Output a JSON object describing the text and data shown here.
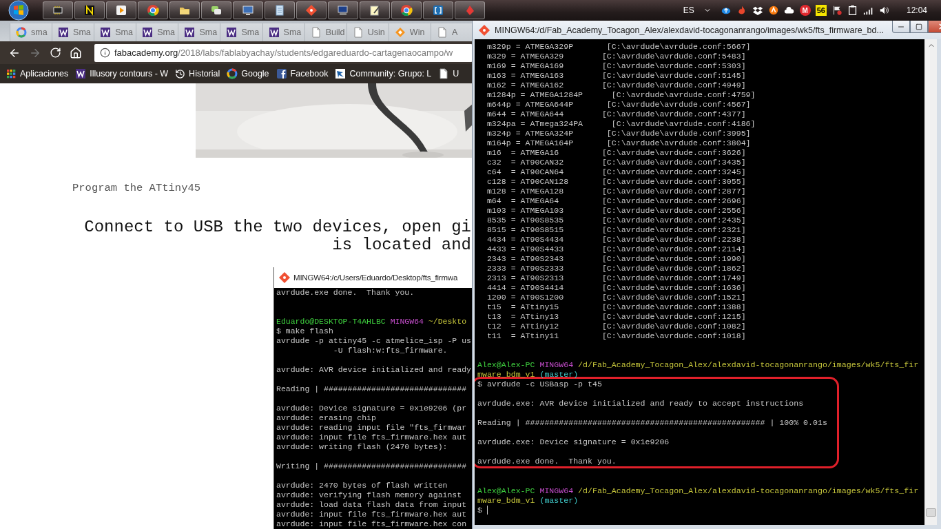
{
  "taskbar": {
    "apps": [
      {
        "kind": "chip"
      },
      {
        "kind": "logo"
      },
      {
        "kind": "player"
      },
      {
        "kind": "browser"
      },
      {
        "kind": "folder"
      },
      {
        "kind": "chat"
      },
      {
        "kind": "monitor"
      },
      {
        "kind": "notepad"
      },
      {
        "kind": "diamond"
      },
      {
        "kind": "computer"
      },
      {
        "kind": "notes"
      },
      {
        "kind": "browser"
      },
      {
        "kind": "bracket"
      },
      {
        "kind": "pin"
      }
    ],
    "language": "ES",
    "tray": [
      {
        "kind": "upload"
      },
      {
        "kind": "flame"
      },
      {
        "kind": "dropbox"
      },
      {
        "kind": "shield"
      },
      {
        "kind": "cloud"
      },
      {
        "kind": "letter",
        "label": "M"
      },
      {
        "kind": "badge",
        "label": "56"
      },
      {
        "kind": "flag"
      },
      {
        "kind": "clipboard"
      },
      {
        "kind": "signal"
      },
      {
        "kind": "speaker"
      }
    ],
    "time": "12:04"
  },
  "browser": {
    "tabs": [
      {
        "kind": "google",
        "label": "sma"
      },
      {
        "kind": "w",
        "label": "Sma"
      },
      {
        "kind": "w",
        "label": "Sma"
      },
      {
        "kind": "w",
        "label": "Sma"
      },
      {
        "kind": "w",
        "label": "Sma"
      },
      {
        "kind": "w",
        "label": "Sma"
      },
      {
        "kind": "w",
        "label": "Sma"
      },
      {
        "kind": "page",
        "label": "Build"
      },
      {
        "kind": "page",
        "label": "Usin"
      },
      {
        "kind": "diamond",
        "label": "Win"
      },
      {
        "kind": "page",
        "label": "A"
      }
    ],
    "url": "fabacademy.org/2018/labs/fablabyachay/students/edgareduardo-cartagenaocampo/w",
    "bookmarks": [
      {
        "kind": "apps",
        "label": "Aplicaciones"
      },
      {
        "kind": "w",
        "label": "Illusory contours - W"
      },
      {
        "kind": "history",
        "label": "Historial"
      },
      {
        "kind": "google",
        "label": "Google"
      },
      {
        "kind": "facebook",
        "label": "Facebook"
      },
      {
        "kind": "bird",
        "label": "Community: Grupo: L"
      },
      {
        "kind": "page",
        "label": "U"
      }
    ],
    "page": {
      "photo": {
        "kind": "picture"
      },
      "caption": "Program the ATtiny45",
      "heading_lines": [
        "Connect to USB the two devices, open gi",
        "is located and"
      ]
    }
  },
  "small_terminal": {
    "title": "MINGW64:/c/Users/Eduardo/Desktop/fts_firmwa",
    "lines": [
      {
        "kind": "text",
        "text": "avrdude.exe done.  Thank you."
      },
      {
        "kind": "blank"
      },
      {
        "kind": "blank"
      },
      {
        "kind": "segs",
        "segs": [
          {
            "kind": "user",
            "text": "Eduardo@DESKTOP-T4AHLBC"
          },
          {
            "kind": "shell",
            "text": "MINGW64"
          },
          {
            "kind": "path",
            "text": "~/Deskto"
          }
        ]
      },
      {
        "kind": "text",
        "text": "$ make flash"
      },
      {
        "kind": "text",
        "text": "avrdude -p attiny45 -c atmelice_isp -P us"
      },
      {
        "kind": "text",
        "text": "            -U flash:w:fts_firmware."
      },
      {
        "kind": "blank"
      },
      {
        "kind": "text",
        "text": "avrdude: AVR device initialized and ready"
      },
      {
        "kind": "blank"
      },
      {
        "kind": "text",
        "text": "Reading | ##############################"
      },
      {
        "kind": "blank"
      },
      {
        "kind": "text",
        "text": "avrdude: Device signature = 0x1e9206 (pr"
      },
      {
        "kind": "text",
        "text": "avrdude: erasing chip"
      },
      {
        "kind": "text",
        "text": "avrdude: reading input file \"fts_firmwar"
      },
      {
        "kind": "text",
        "text": "avrdude: input file fts_firmware.hex aut"
      },
      {
        "kind": "text",
        "text": "avrdude: writing flash (2470 bytes):"
      },
      {
        "kind": "blank"
      },
      {
        "kind": "text",
        "text": "Writing | ##############################"
      },
      {
        "kind": "blank"
      },
      {
        "kind": "text",
        "text": "avrdude: 2470 bytes of flash written"
      },
      {
        "kind": "text",
        "text": "avrdude: verifying flash memory against"
      },
      {
        "kind": "text",
        "text": "avrdude: load data flash data from input"
      },
      {
        "kind": "text",
        "text": "avrdude: input file fts_firmware.hex aut"
      },
      {
        "kind": "text",
        "text": "avrdude: input file fts_firmware.hex con"
      }
    ]
  },
  "terminal": {
    "title": "MINGW64:/d/Fab_Academy_Tocagon_Alex/alexdavid-tocagonanrango/images/wk5/fts_firmware_bd...",
    "lines": [
      {
        "kind": "device",
        "name": "m329p = ATMEGA329P",
        "conf": "[C:\\avrdude\\avrdude.conf:5667]"
      },
      {
        "kind": "device",
        "name": "m329 = ATMEGA329",
        "conf": "[C:\\avrdude\\avrdude.conf:5483]"
      },
      {
        "kind": "device",
        "name": "m169 = ATMEGA169",
        "conf": "[C:\\avrdude\\avrdude.conf:5303]"
      },
      {
        "kind": "device",
        "name": "m163 = ATMEGA163",
        "conf": "[C:\\avrdude\\avrdude.conf:5145]"
      },
      {
        "kind": "device",
        "name": "m162 = ATMEGA162",
        "conf": "[C:\\avrdude\\avrdude.conf:4949]"
      },
      {
        "kind": "device",
        "name": "m1284p = ATMEGA1284P",
        "conf": "[C:\\avrdude\\avrdude.conf:4759]"
      },
      {
        "kind": "device",
        "name": "m644p = ATMEGA644P",
        "conf": "[C:\\avrdude\\avrdude.conf:4567]"
      },
      {
        "kind": "device",
        "name": "m644 = ATMEGA644",
        "conf": "[C:\\avrdude\\avrdude.conf:4377]"
      },
      {
        "kind": "device",
        "name": "m324pa = ATmega324PA",
        "conf": "[C:\\avrdude\\avrdude.conf:4186]"
      },
      {
        "kind": "device",
        "name": "m324p = ATMEGA324P",
        "conf": "[C:\\avrdude\\avrdude.conf:3995]"
      },
      {
        "kind": "device",
        "name": "m164p = ATMEGA164P",
        "conf": "[C:\\avrdude\\avrdude.conf:3804]"
      },
      {
        "kind": "device",
        "name": "m16  = ATMEGA16",
        "conf": "[C:\\avrdude\\avrdude.conf:3626]"
      },
      {
        "kind": "device",
        "name": "c32  = AT90CAN32",
        "conf": "[C:\\avrdude\\avrdude.conf:3435]"
      },
      {
        "kind": "device",
        "name": "c64  = AT90CAN64",
        "conf": "[C:\\avrdude\\avrdude.conf:3245]"
      },
      {
        "kind": "device",
        "name": "c128 = AT90CAN128",
        "conf": "[C:\\avrdude\\avrdude.conf:3055]"
      },
      {
        "kind": "device",
        "name": "m128 = ATMEGA128",
        "conf": "[C:\\avrdude\\avrdude.conf:2877]"
      },
      {
        "kind": "device",
        "name": "m64  = ATMEGA64",
        "conf": "[C:\\avrdude\\avrdude.conf:2696]"
      },
      {
        "kind": "device",
        "name": "m103 = ATMEGA103",
        "conf": "[C:\\avrdude\\avrdude.conf:2556]"
      },
      {
        "kind": "device",
        "name": "8535 = AT90S8535",
        "conf": "[C:\\avrdude\\avrdude.conf:2435]"
      },
      {
        "kind": "device",
        "name": "8515 = AT90S8515",
        "conf": "[C:\\avrdude\\avrdude.conf:2321]"
      },
      {
        "kind": "device",
        "name": "4434 = AT90S4434",
        "conf": "[C:\\avrdude\\avrdude.conf:2238]"
      },
      {
        "kind": "device",
        "name": "4433 = AT90S4433",
        "conf": "[C:\\avrdude\\avrdude.conf:2114]"
      },
      {
        "kind": "device",
        "name": "2343 = AT90S2343",
        "conf": "[C:\\avrdude\\avrdude.conf:1990]"
      },
      {
        "kind": "device",
        "name": "2333 = AT90S2333",
        "conf": "[C:\\avrdude\\avrdude.conf:1862]"
      },
      {
        "kind": "device",
        "name": "2313 = AT90S2313",
        "conf": "[C:\\avrdude\\avrdude.conf:1749]"
      },
      {
        "kind": "device",
        "name": "4414 = AT90S4414",
        "conf": "[C:\\avrdude\\avrdude.conf:1636]"
      },
      {
        "kind": "device",
        "name": "1200 = AT90S1200",
        "conf": "[C:\\avrdude\\avrdude.conf:1521]"
      },
      {
        "kind": "device",
        "name": "t15  = ATtiny15",
        "conf": "[C:\\avrdude\\avrdude.conf:1388]"
      },
      {
        "kind": "device",
        "name": "t13  = ATtiny13",
        "conf": "[C:\\avrdude\\avrdude.conf:1215]"
      },
      {
        "kind": "device",
        "name": "t12  = ATtiny12",
        "conf": "[C:\\avrdude\\avrdude.conf:1082]"
      },
      {
        "kind": "device",
        "name": "t11  = ATtiny11",
        "conf": "[C:\\avrdude\\avrdude.conf:1018]"
      },
      {
        "kind": "blank"
      },
      {
        "kind": "blank"
      },
      {
        "kind": "segs",
        "segs": [
          {
            "kind": "user",
            "text": "Alex@Alex-PC"
          },
          {
            "kind": "shell",
            "text": "MINGW64"
          },
          {
            "kind": "path",
            "text": "/d/Fab_Academy_Tocagon_Alex/alexdavid-tocagonanrango/images/wk5/fts_fir"
          }
        ]
      },
      {
        "kind": "segs",
        "segs": [
          {
            "kind": "path",
            "text": "mware_bdm_v1"
          },
          {
            "kind": "branch",
            "text": "(master)"
          }
        ]
      },
      {
        "kind": "box",
        "lines": [
          {
            "kind": "text",
            "text": "$ avrdude -c USBasp -p t45"
          },
          {
            "kind": "blank"
          },
          {
            "kind": "text",
            "text": "avrdude.exe: AVR device initialized and ready to accept instructions"
          },
          {
            "kind": "blank"
          },
          {
            "kind": "text",
            "text": "Reading | ################################################## | 100% 0.01s"
          },
          {
            "kind": "blank"
          },
          {
            "kind": "text",
            "text": "avrdude.exe: Device signature = 0x1e9206"
          },
          {
            "kind": "blank"
          },
          {
            "kind": "text",
            "text": "avrdude.exe done.  Thank you."
          }
        ]
      },
      {
        "kind": "blank"
      },
      {
        "kind": "blank"
      },
      {
        "kind": "segs",
        "segs": [
          {
            "kind": "user",
            "text": "Alex@Alex-PC"
          },
          {
            "kind": "shell",
            "text": "MINGW64"
          },
          {
            "kind": "path",
            "text": "/d/Fab_Academy_Tocagon_Alex/alexdavid-tocagonanrango/images/wk5/fts_fir"
          }
        ]
      },
      {
        "kind": "segs",
        "segs": [
          {
            "kind": "path",
            "text": "mware_bdm_v1"
          },
          {
            "kind": "branch",
            "text": "(master)"
          }
        ]
      },
      {
        "kind": "cursor",
        "text": "$"
      }
    ]
  }
}
